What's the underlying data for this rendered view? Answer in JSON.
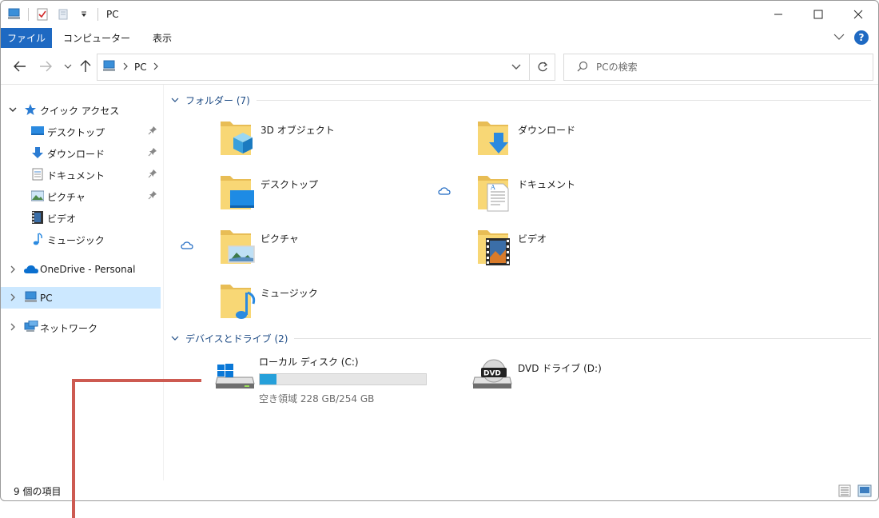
{
  "window": {
    "title": "PC",
    "controls": [
      "minimize",
      "maximize",
      "close"
    ]
  },
  "ribbon": {
    "tabs": [
      "ファイル",
      "コンピューター",
      "表示"
    ]
  },
  "address": {
    "crumbs": [
      "PC"
    ],
    "search_placeholder": "PCの検索"
  },
  "nav": {
    "quick_access": "クイック アクセス",
    "quick_items": [
      {
        "label": "デスクトップ",
        "icon": "desktop-icon",
        "pinned": true
      },
      {
        "label": "ダウンロード",
        "icon": "download-icon",
        "pinned": true
      },
      {
        "label": "ドキュメント",
        "icon": "document-icon",
        "pinned": true
      },
      {
        "label": "ピクチャ",
        "icon": "picture-icon",
        "pinned": true
      },
      {
        "label": "ビデオ",
        "icon": "video-icon",
        "pinned": false
      },
      {
        "label": "ミュージック",
        "icon": "music-icon",
        "pinned": false
      }
    ],
    "onedrive": "OneDrive - Personal",
    "pc": "PC",
    "network": "ネットワーク"
  },
  "content": {
    "folders_group": "フォルダー (7)",
    "folders": [
      {
        "label": "3D オブジェクト",
        "icon": "3d-objects-icon"
      },
      {
        "label": "ダウンロード",
        "icon": "downloads-folder-icon"
      },
      {
        "label": "デスクトップ",
        "icon": "desktop-folder-icon"
      },
      {
        "label": "ドキュメント",
        "icon": "documents-folder-icon",
        "cloud": true
      },
      {
        "label": "ピクチャ",
        "icon": "pictures-folder-icon",
        "cloud": true
      },
      {
        "label": "ビデオ",
        "icon": "videos-folder-icon"
      },
      {
        "label": "ミュージック",
        "icon": "music-folder-icon"
      }
    ],
    "devices_group": "デバイスとドライブ (2)",
    "drives": [
      {
        "label": "ローカル ディスク (C:)",
        "free": "空き領域 228 GB/254 GB",
        "used_fraction": 0.1,
        "icon": "local-disk-icon"
      },
      {
        "label": "DVD ドライブ (D:)",
        "icon": "dvd-drive-icon"
      }
    ]
  },
  "status": {
    "count": "9 個の項目"
  },
  "colors": {
    "accent": "#1e69c2",
    "selection": "#cce8ff",
    "drive_fill": "#26a0da",
    "annotation": "#cd5a51",
    "group_text": "#1c4a84"
  }
}
